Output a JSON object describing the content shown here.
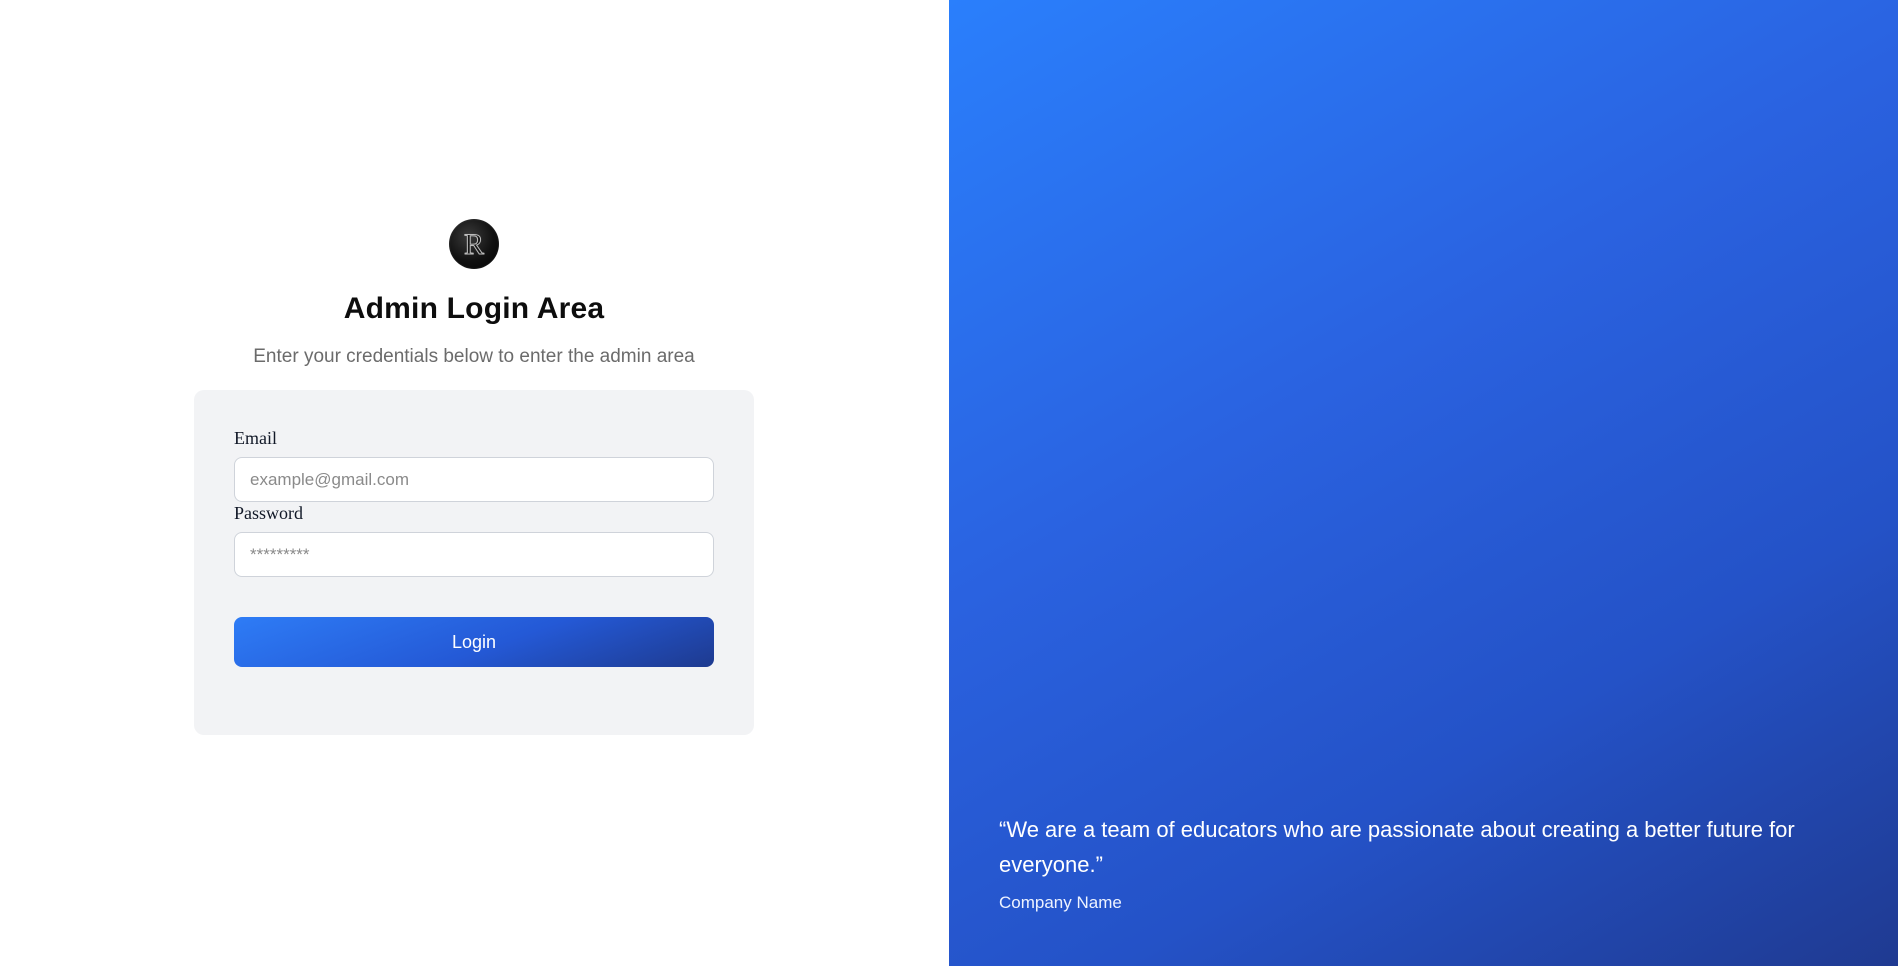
{
  "brand": {
    "logo_letter": "R"
  },
  "login": {
    "title": "Admin Login Area",
    "subtitle": "Enter your credentials below to enter the admin area",
    "email_label": "Email",
    "email_placeholder": "example@gmail.com",
    "email_value": "",
    "password_label": "Password",
    "password_placeholder": "*********",
    "password_value": "",
    "login_button_label": "Login"
  },
  "testimonial": {
    "quote": "“We are a team of educators who are passionate about creating a better future for everyone.”",
    "author": "Company Name"
  },
  "colors": {
    "accent_start": "#2e7cf6",
    "accent_end": "#1e3a8f",
    "card_background": "#f2f3f5",
    "panel_gradient_start": "#2a7ffc",
    "panel_gradient_end": "#1f3a91"
  },
  "icons": {
    "logo": "brand-logo-icon"
  }
}
